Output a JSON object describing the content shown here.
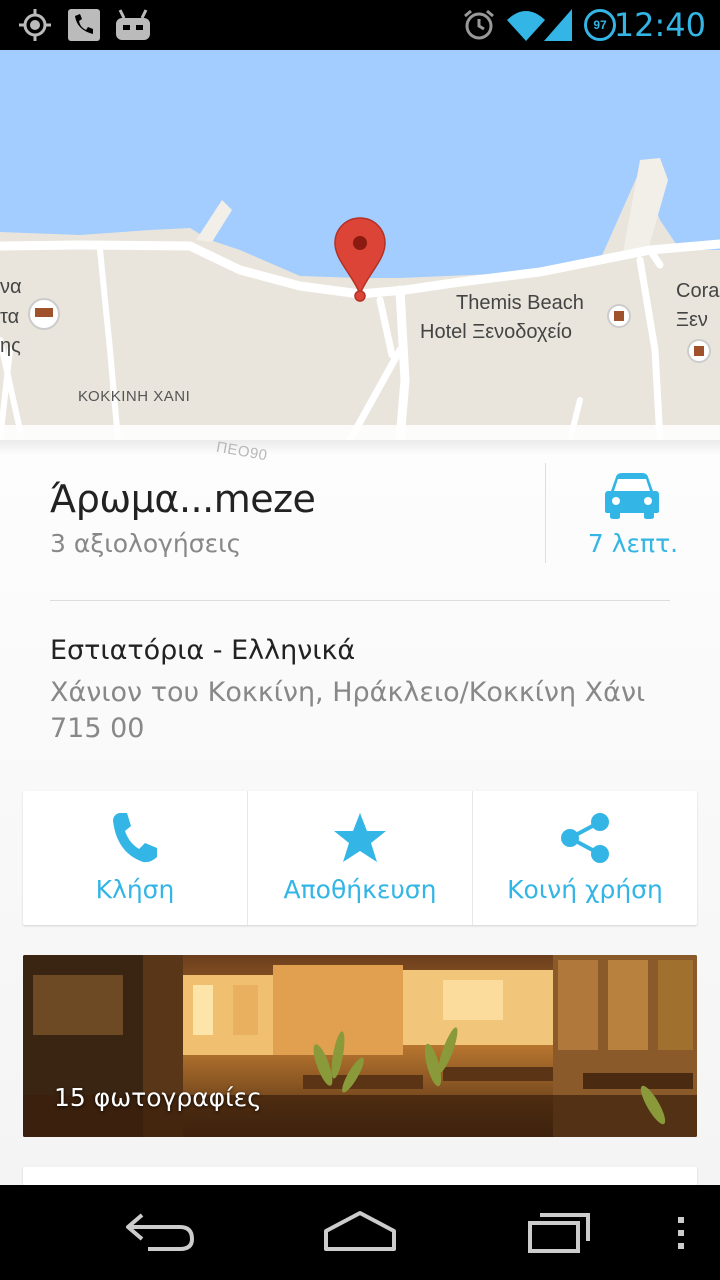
{
  "status_bar": {
    "time": "12:40",
    "battery_level": "97",
    "icons": [
      "gps-icon",
      "phone-signal-icon",
      "android-icon",
      "alarm-icon",
      "wifi-icon",
      "cell-signal-icon"
    ]
  },
  "map": {
    "labels": {
      "left_1": "να",
      "left_2": "τα",
      "left_3": "ης",
      "district": "ΚΟΚΚΙΝΗ ΧΑΝΙ",
      "hotel_line1": "Themis Beach",
      "hotel_line2": "Hotel Ξενοδοχείο",
      "right_1": "Cora",
      "right_2": "Ξεν",
      "road": "ΠΕΟ90"
    },
    "pin_color": "#db4437",
    "water_color": "#a3ccff"
  },
  "place": {
    "title": "Άρωμα...meze",
    "reviews": "3 αξιολογήσεις",
    "drive_time": "7 λεπτ.",
    "category": "Εστιατόρια - Ελληνικά",
    "address": "Χάνιον του Κοκκίνη, Ηράκλειο/Κοκκίνη Χάνι 715 00"
  },
  "actions": {
    "call": "Κλήση",
    "save": "Αποθήκευση",
    "share": "Κοινή χρήση"
  },
  "photos": {
    "count_label": "15 φωτογραφίες"
  },
  "colors": {
    "accent": "#33b5e5"
  }
}
